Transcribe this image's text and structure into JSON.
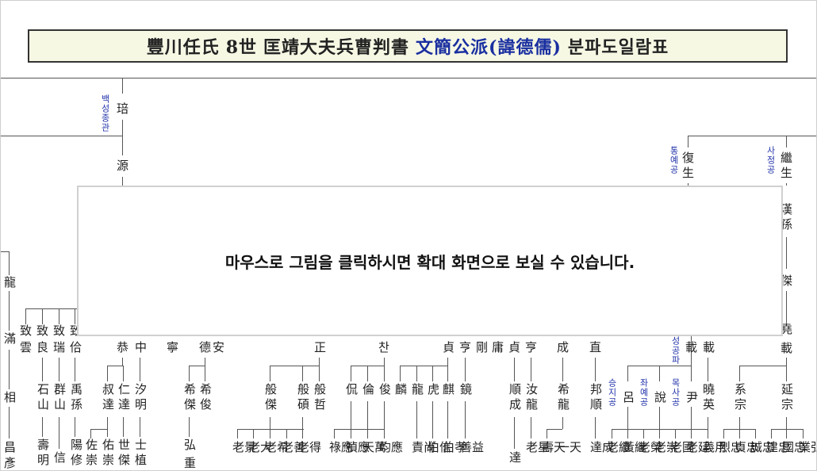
{
  "title": {
    "part1": "豐川任氏",
    "part2": "8世",
    "part3": "匡靖大夫兵曹判書",
    "part4": "文簡公派(諱德儒)",
    "part5": "분파도일람표"
  },
  "labels": {
    "baekseong": "백성종관",
    "tongye": "통예공",
    "sajeong": "사정공",
    "seonggong": "성공파",
    "seungji": "승지공",
    "jwaye": "좌예공",
    "moksa": "목사공"
  },
  "names": {
    "pa": "琣",
    "won": "源",
    "boksaeng": "復生",
    "gyesaeng": "繼生",
    "hanson": "漢孫",
    "geol": "傑",
    "yo": "堯",
    "jae": "載",
    "yong": "龍",
    "man": "滿",
    "sang": "相",
    "chang": "昌",
    "eon": "彥",
    "ch1": "致",
    "ch1b": "雲",
    "ch2": "致",
    "ch2b": "良",
    "ch3": "致",
    "ch3b": "瑞",
    "ch4": "致",
    "ch4b": "佮",
    "seoksan": "石山",
    "gunsan": "群山",
    "usun": "禹孫",
    "sumyeong": "壽明",
    "sin": "信",
    "yangsu": "陽修",
    "chu": "恭",
    "jung": "中",
    "ling": "寧",
    "deokan": "德安",
    "sugdal": "叔達",
    "indal": "仁達",
    "samyeong": "汐明",
    "jwasung": "佐崇",
    "usung": "佑崇",
    "segeol": "世傑",
    "sasik": "士植",
    "hwigeol": "希傑",
    "hwijun": "希俊",
    "hong": "弘",
    "jung2": "重",
    "jeong": "正",
    "chan": "찬",
    "jeong2": "貞",
    "hyeong": "亨",
    "gang": "剛",
    "yong2": "庸",
    "jeong3": "貞",
    "hyeong2": "亨",
    "seong": "成",
    "jik": "直",
    "bangeol": "般傑",
    "banseok": "般碩",
    "banjeol": "般哲",
    "ryun": "侃",
    "lun": "倫",
    "jun": "俊",
    "rin": "麟",
    "ryong": "龍",
    "ho": "虎",
    "gi": "麒",
    "gyeong": "鏡",
    "sunseong": "順成",
    "hyeol": "汝龍",
    "hwiryong": "希龍",
    "bangsun": "邦順",
    "yeo": "呂",
    "seol": "說",
    "yun": "尹",
    "hyo": "曉英",
    "gye": "系宗",
    "yeonjong": "延宗",
    "grand": [
      "景老",
      "大老",
      "希老",
      "善老",
      "得老",
      "應祿",
      "應禎",
      "萬天",
      "應均",
      "尚責",
      "信伯",
      "孝伯",
      "益善",
      "達",
      "星老",
      "天壽",
      "天一",
      "成達",
      "繼老",
      "繼黃",
      "榮老",
      "崇老",
      "國老",
      "廷老",
      "用義",
      "忠烈",
      "忠貞",
      "忠誠",
      "忠建",
      "忠國",
      "弘業"
    ]
  },
  "overlay": {
    "message": "마우스로 그림을 클릭하시면 확대 화면으로  보실 수 있습니다."
  }
}
